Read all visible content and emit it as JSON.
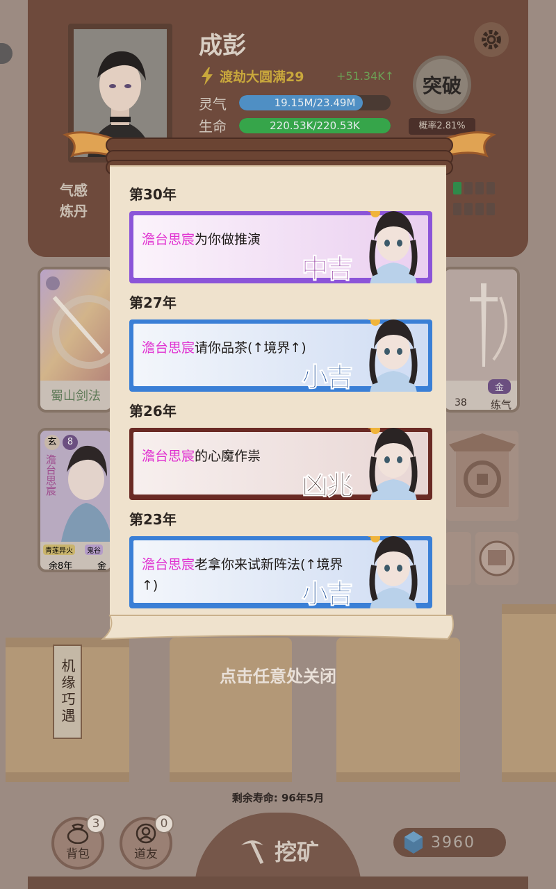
{
  "player": {
    "name": "成彭",
    "realm": "渡劫大圆满29",
    "exp_rate": "+51.34K↑",
    "stats": [
      {
        "label": "灵气",
        "value": "19.15M/23.49M",
        "fill": 0.815,
        "color": "#4f8fc4"
      },
      {
        "label": "生命",
        "value": "220.53K/220.53K",
        "fill": 1.0,
        "color": "#36a54a"
      }
    ],
    "breakthrough_label": "突破",
    "probability": "概率2.81%"
  },
  "skills": [
    {
      "label": "气感"
    },
    {
      "label": "炼丹"
    }
  ],
  "background_cards": {
    "card1_caption": "蜀山剑法",
    "card2_caption": "练气",
    "card2_chip": "金",
    "card2_level": "38",
    "companion": {
      "rank": "玄",
      "level": "8",
      "name": "澹台思宸",
      "tags": [
        "青莲异火",
        "鬼谷"
      ],
      "remaining": "余8年",
      "element": "金"
    }
  },
  "opportunity_sign": "机缘巧遇",
  "modal": {
    "close_hint": "点击任意处关闭",
    "entries": [
      {
        "year": "第30年",
        "npc": "澹台思宸",
        "text": "为你做推演",
        "fortune": "中吉",
        "theme": "purple"
      },
      {
        "year": "第27年",
        "npc": "澹台思宸",
        "text": "请你品茶(↑境界↑)",
        "fortune": "小吉",
        "theme": "blue"
      },
      {
        "year": "第26年",
        "npc": "澹台思宸",
        "text": "的心魔作祟",
        "fortune": "凶兆",
        "theme": "red"
      },
      {
        "year": "第23年",
        "npc": "澹台思宸",
        "text": "老拿你来试新阵法(↑境界↑)",
        "fortune": "小吉",
        "theme": "blue"
      }
    ]
  },
  "footer": {
    "lifespan": "剩余寿命: 96年5月",
    "bag_label": "背包",
    "bag_count": "3",
    "friends_label": "道友",
    "friends_count": "0",
    "mine_label": "挖矿",
    "gems": "3960"
  },
  "colors": {
    "npc_name": "#e02ed0",
    "purple_border": "#8b54d8",
    "blue_border": "#3a7fd6",
    "red_border": "#6a2a24"
  }
}
